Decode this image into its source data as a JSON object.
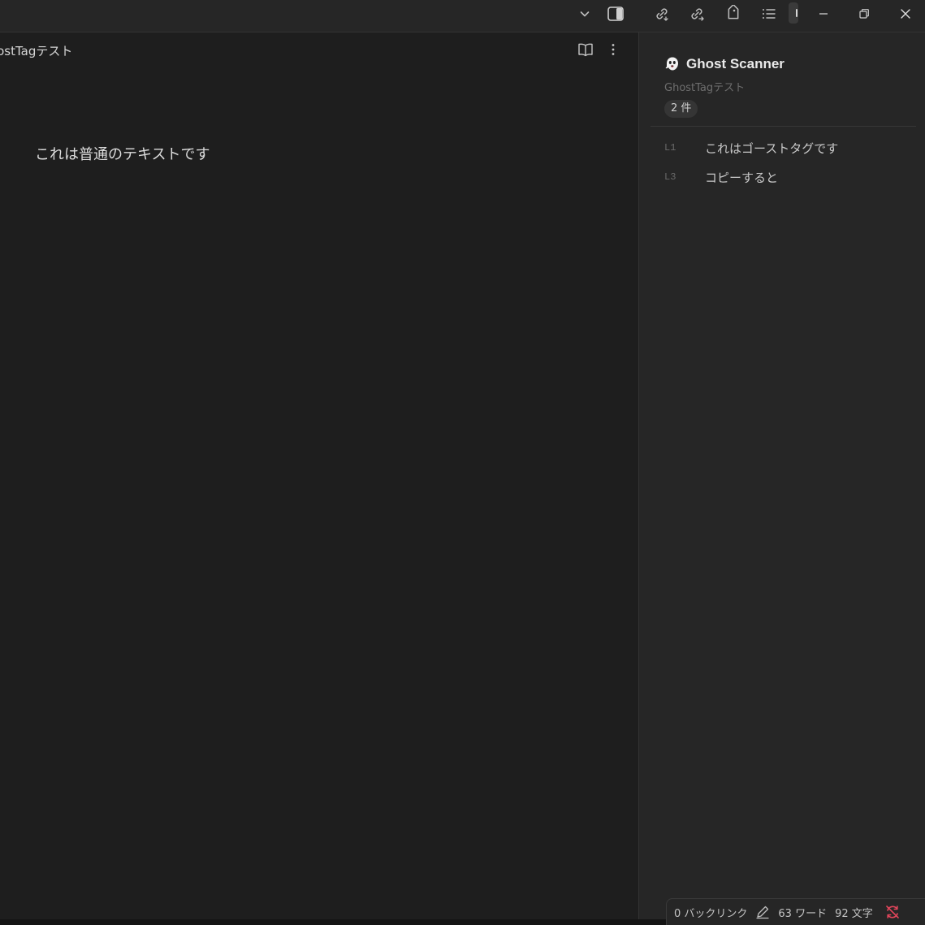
{
  "editor": {
    "tab_title": "GhostTagテスト",
    "body_text": "これは普通のテキストです"
  },
  "sidebar": {
    "title": "Ghost Scanner",
    "file_name": "GhostTagテスト",
    "count_badge": "2 件",
    "results": [
      {
        "line": "L1",
        "text": "これはゴーストタグです"
      },
      {
        "line": "L3",
        "text": "コピーすると"
      }
    ]
  },
  "statusbar": {
    "backlinks": "0 バックリンク",
    "words": "63 ワード",
    "chars": "92 文字"
  },
  "colors": {
    "sync_error": "#e0455a",
    "background": "#1e1e1e",
    "sidebar": "#262626"
  },
  "icons": {
    "titlebar": [
      "chevron-down-icon",
      "sidebar-toggle-icon",
      "link-incoming-icon",
      "link-outgoing-icon",
      "tag-icon",
      "list-icon",
      "minimize-icon",
      "restore-icon",
      "close-icon"
    ],
    "editor_header": [
      "book-open-icon",
      "more-vertical-icon"
    ],
    "statusbar": [
      "pencil-icon",
      "sync-error-icon"
    ],
    "sidebar": [
      "ghost-icon"
    ]
  }
}
